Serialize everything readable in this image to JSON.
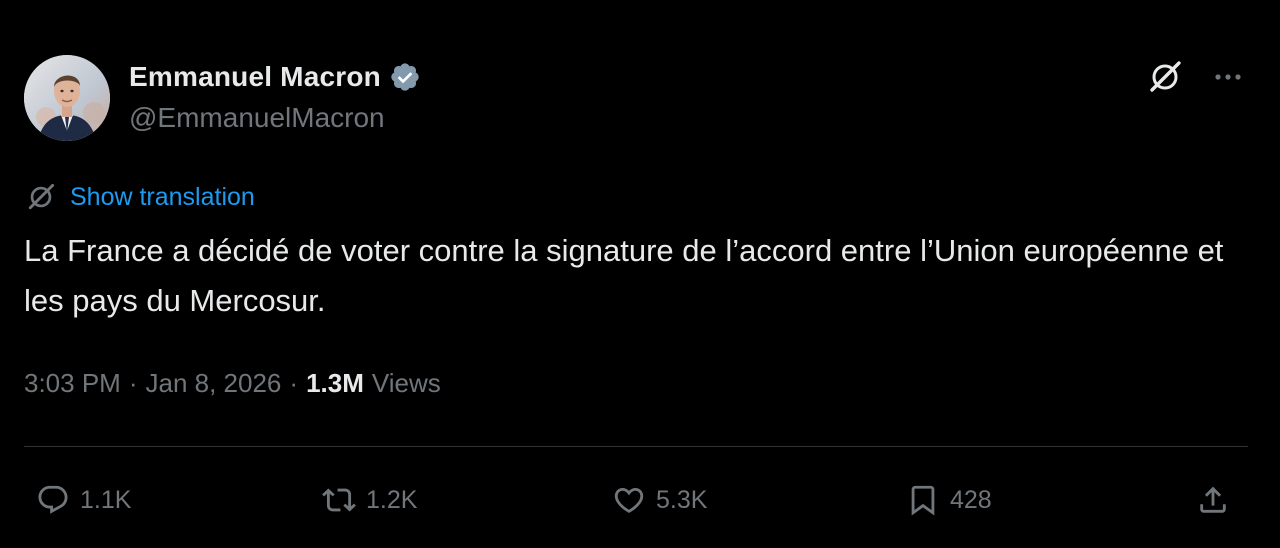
{
  "author": {
    "display_name": "Emmanuel Macron",
    "handle": "@EmmanuelMacron",
    "verified_icon": "verified-badge-icon",
    "verified_color": "#829aab"
  },
  "top_actions": {
    "grok_icon": "grok-icon",
    "more_icon": "more-icon"
  },
  "translation": {
    "icon": "grok-translate-icon",
    "label": "Show translation"
  },
  "tweet": {
    "text": "La France a décidé de voter contre la signature de l’accord entre l’Union européenne et les pays du Mercosur."
  },
  "meta": {
    "time": "3:03 PM",
    "separator": "·",
    "date": "Jan 8, 2026",
    "views_count": "1.3M",
    "views_label": "Views"
  },
  "actions": {
    "reply": {
      "icon": "reply-icon",
      "count": "1.1K"
    },
    "repost": {
      "icon": "repost-icon",
      "count": "1.2K"
    },
    "like": {
      "icon": "heart-icon",
      "count": "5.3K"
    },
    "bookmark": {
      "icon": "bookmark-icon",
      "count": "428"
    },
    "share": {
      "icon": "share-icon"
    }
  },
  "colors": {
    "background": "#000000",
    "primary_text": "#e7e9ea",
    "secondary_text": "#71767b",
    "link": "#1d9bf0",
    "divider": "#2f3336"
  }
}
